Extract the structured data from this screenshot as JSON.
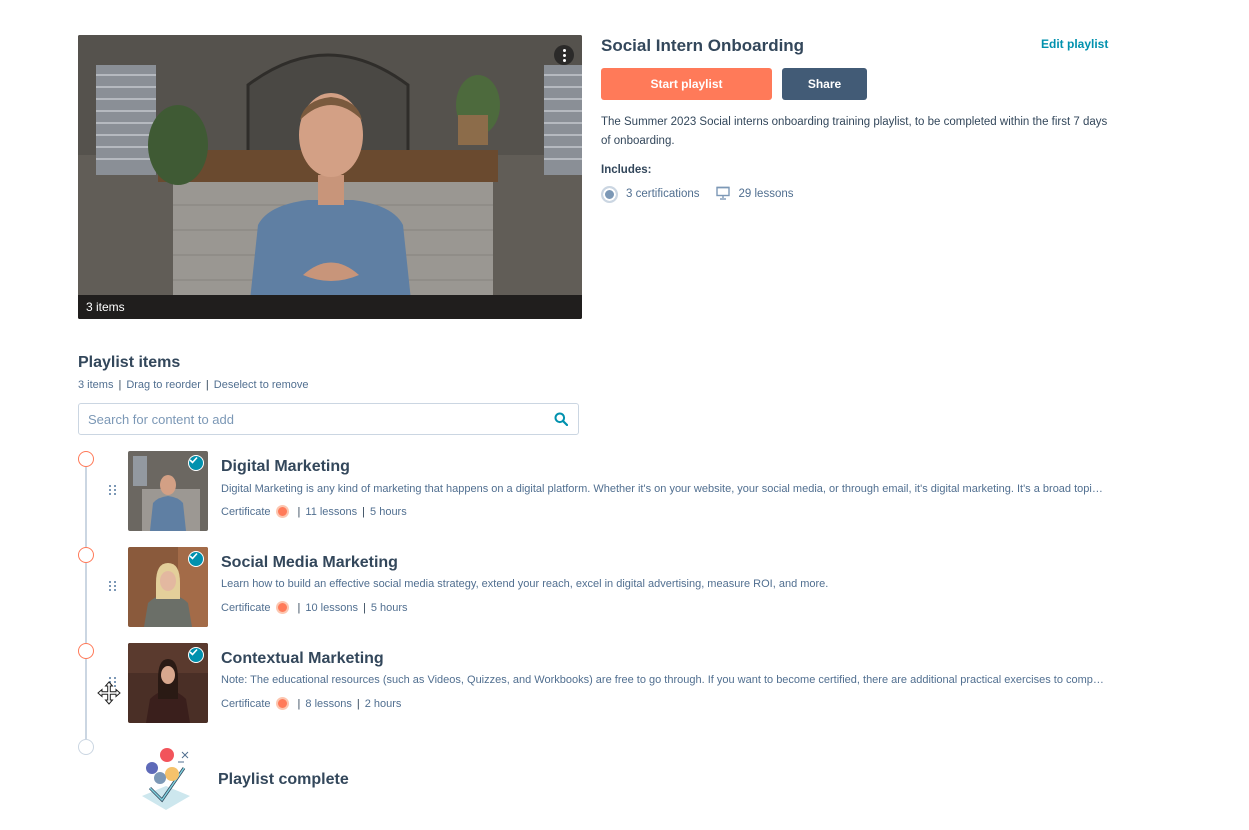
{
  "hero": {
    "items_label": "3 items",
    "menu_icon": "kebab-menu-icon"
  },
  "header": {
    "title": "Social Intern Onboarding",
    "edit_link": "Edit playlist",
    "start_button": "Start playlist",
    "share_button": "Share",
    "description": "The Summer 2023 Social interns onboarding training playlist, to be completed within the first 7 days of onboarding.",
    "includes_label": "Includes:",
    "certifications": "3 certifications",
    "lessons": "29 lessons"
  },
  "playlist": {
    "title": "Playlist items",
    "sub": {
      "count": "3 items",
      "drag": "Drag to reorder",
      "deselect": "Deselect to remove"
    },
    "search_placeholder": "Search for content to add",
    "items": [
      {
        "title": "Digital Marketing",
        "description": "Digital Marketing is any kind of marketing that happens on a digital platform. Whether it's on your website, your social media, or through email, it's digital marketing. It's a broad topic that covers many strategies and tactics.",
        "certificate": "Certificate",
        "lessons": "11 lessons",
        "duration": "5 hours"
      },
      {
        "title": "Social Media Marketing",
        "description": "Learn how to build an effective social media strategy, extend your reach, excel in digital advertising, measure ROI, and more.",
        "certificate": "Certificate",
        "lessons": "10 lessons",
        "duration": "5 hours"
      },
      {
        "title": "Contextual Marketing",
        "description": "Note: The educational resources (such as Videos, Quizzes, and Workbooks) are free to go through. If you want to become certified, there are additional practical exercises to complete.",
        "certificate": "Certificate",
        "lessons": "8 lessons",
        "duration": "2 hours"
      }
    ],
    "complete_label": "Playlist complete"
  },
  "colors": {
    "accent": "#ff7a59",
    "secondary": "#425b76",
    "link": "#0091ae",
    "text": "#33475b",
    "muted": "#516f90"
  }
}
